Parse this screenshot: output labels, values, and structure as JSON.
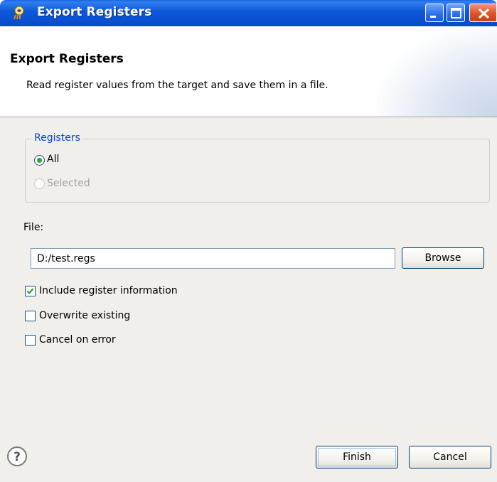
{
  "window": {
    "title": "Export Registers",
    "controls": [
      "minimize",
      "maximize",
      "close"
    ]
  },
  "banner": {
    "title": "Export Registers",
    "description": "Read register values from the target and save them in a file."
  },
  "registers": {
    "legend": "Registers",
    "options": [
      {
        "label": "All",
        "selected": true,
        "enabled": true
      },
      {
        "label": "Selected",
        "selected": false,
        "enabled": false
      }
    ]
  },
  "file": {
    "label": "File:",
    "value": "D:/test.regs",
    "browse_label": "Browse"
  },
  "options": [
    {
      "label": "Include register information",
      "checked": true
    },
    {
      "label": "Overwrite existing",
      "checked": false
    },
    {
      "label": "Cancel on error",
      "checked": false
    }
  ],
  "footer": {
    "finish_label": "Finish",
    "cancel_label": "Cancel",
    "help_icon": "help-icon"
  },
  "colors": {
    "titlebar": "#0a4fd0",
    "legend_text": "#0046d5",
    "body_background": "#f0efec"
  }
}
